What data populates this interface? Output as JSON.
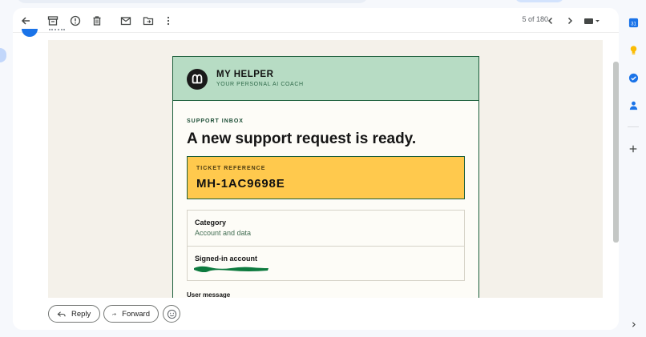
{
  "toolbar": {
    "back": "back-arrow-icon",
    "archive": "archive-icon",
    "report": "report-spam-icon",
    "delete": "trash-icon",
    "mark_unread": "mark-unread-icon",
    "move": "move-to-folder-icon",
    "more": "more-vert-icon",
    "pagination": "5 of 180",
    "prev": "chevron-left-icon",
    "next": "chevron-right-icon",
    "input_tools": "keyboard-icon"
  },
  "email": {
    "brand": {
      "name": "MY HELPER",
      "tagline": "YOUR PERSONAL AI COACH"
    },
    "eyebrow": "SUPPORT INBOX",
    "headline": "A new support request is ready.",
    "ticket": {
      "label": "TICKET REFERENCE",
      "value": "MH-1AC9698E"
    },
    "fields": [
      {
        "label": "Category",
        "value": "Account and data"
      },
      {
        "label": "Signed-in account",
        "value": ""
      }
    ],
    "next_section_label": "User message"
  },
  "actions": {
    "reply": "Reply",
    "forward": "Forward",
    "emoji": "smiley-icon"
  },
  "side_rail": [
    "calendar-icon",
    "keep-icon",
    "tasks-icon",
    "contacts-icon",
    "add-icon",
    "expand-icon"
  ],
  "colors": {
    "header_bg": "#b7dcc4",
    "ticket_bg": "#ffc94d",
    "border_green": "#1b5e3b",
    "canvas_bg": "#f4f1ea",
    "redaction": "#0d7a3e"
  }
}
